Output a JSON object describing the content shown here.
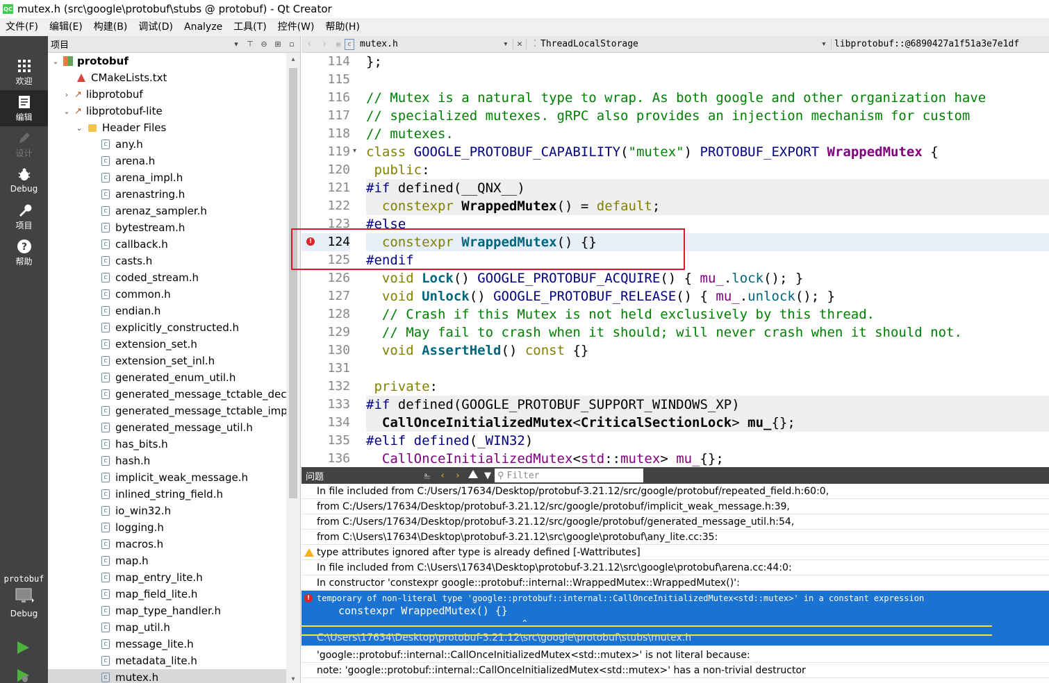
{
  "window": {
    "title": "mutex.h (src\\google\\protobuf\\stubs @ protobuf) - Qt Creator",
    "logo": "QC"
  },
  "menu": [
    "文件(F)",
    "编辑(E)",
    "构建(B)",
    "调试(D)",
    "Analyze",
    "工具(T)",
    "控件(W)",
    "帮助(H)"
  ],
  "modes": [
    {
      "label": "欢迎",
      "icon": "grid-icon"
    },
    {
      "label": "编辑",
      "icon": "edit-icon"
    },
    {
      "label": "设计",
      "icon": "pencil-icon"
    },
    {
      "label": "Debug",
      "icon": "bug-icon"
    },
    {
      "label": "项目",
      "icon": "wrench-icon"
    },
    {
      "label": "帮助",
      "icon": "help-icon"
    }
  ],
  "kit": {
    "project": "protobuf",
    "config": "Debug"
  },
  "project_panel": {
    "title": "项目"
  },
  "tree": {
    "root": "protobuf",
    "cmake": "CMakeLists.txt",
    "libprotobuf": "libprotobuf",
    "libprotobuf_lite": "libprotobuf-lite",
    "header_files": "Header Files",
    "files": [
      "any.h",
      "arena.h",
      "arena_impl.h",
      "arenastring.h",
      "arenaz_sampler.h",
      "bytestream.h",
      "callback.h",
      "casts.h",
      "coded_stream.h",
      "common.h",
      "endian.h",
      "explicitly_constructed.h",
      "extension_set.h",
      "extension_set_inl.h",
      "generated_enum_util.h",
      "generated_message_tctable_decl.h",
      "generated_message_tctable_impl.h",
      "generated_message_util.h",
      "has_bits.h",
      "hash.h",
      "implicit_weak_message.h",
      "inlined_string_field.h",
      "io_win32.h",
      "logging.h",
      "macros.h",
      "map.h",
      "map_entry_lite.h",
      "map_field_lite.h",
      "map_type_handler.h",
      "map_util.h",
      "message_lite.h",
      "metadata_lite.h",
      "mutex.h"
    ],
    "selected": "mutex.h"
  },
  "editor": {
    "file": "mutex.h",
    "symbol": "ThreadLocalStorage",
    "scope": "libprotobuf::@6890427a1f51a3e7e1df",
    "line_numbers": [
      "114",
      "115",
      "116",
      "117",
      "118",
      "119",
      "120",
      "121",
      "122",
      "123",
      "124",
      "125",
      "126",
      "127",
      "128",
      "129",
      "130",
      "131",
      "132",
      "133",
      "134",
      "135",
      "136"
    ],
    "error_line": "124"
  },
  "issues": {
    "title": "问题",
    "filter_placeholder": "Filter",
    "rows": [
      "In file included from C:/Users/17634/Desktop/protobuf-3.21.12/src/google/protobuf/repeated_field.h:60:0,",
      "from C:/Users/17634/Desktop/protobuf-3.21.12/src/google/protobuf/implicit_weak_message.h:39,",
      "from C:/Users/17634/Desktop/protobuf-3.21.12/src/google/protobuf/generated_message_util.h:54,",
      "from C:\\Users\\17634\\Desktop\\protobuf-3.21.12\\src\\google\\protobuf\\any_lite.cc:35:",
      "type attributes ignored after type is already defined [-Wattributes]",
      "In file included from C:\\Users\\17634\\Desktop\\protobuf-3.21.12\\src\\google\\protobuf\\arena.cc:44:0:",
      "In constructor 'constexpr google::protobuf::internal::WrappedMutex::WrappedMutex()':"
    ],
    "selected_msg": "temporary of non-literal type 'google::protobuf::internal::CallOnceInitializedMutex<std::mutex>' in a constant expression",
    "selected_code": "constexpr WrappedMutex() {}",
    "selected_caret": "^",
    "selected_path": "C:\\Users\\17634\\Desktop\\protobuf-3.21.12\\src\\google\\protobuf\\stubs\\mutex.h",
    "after": [
      "'google::protobuf::internal::CallOnceInitializedMutex<std::mutex>' is not literal because:",
      "note:   'google::protobuf::internal::CallOnceInitializedMutex<std::mutex>' has a non-trivial destructor"
    ]
  },
  "colors": {
    "sidebar": "#404244",
    "selection": "#1b73d1",
    "error": "#d9262b",
    "warning": "#f2b21b",
    "highlight_box": "#e0192a"
  }
}
